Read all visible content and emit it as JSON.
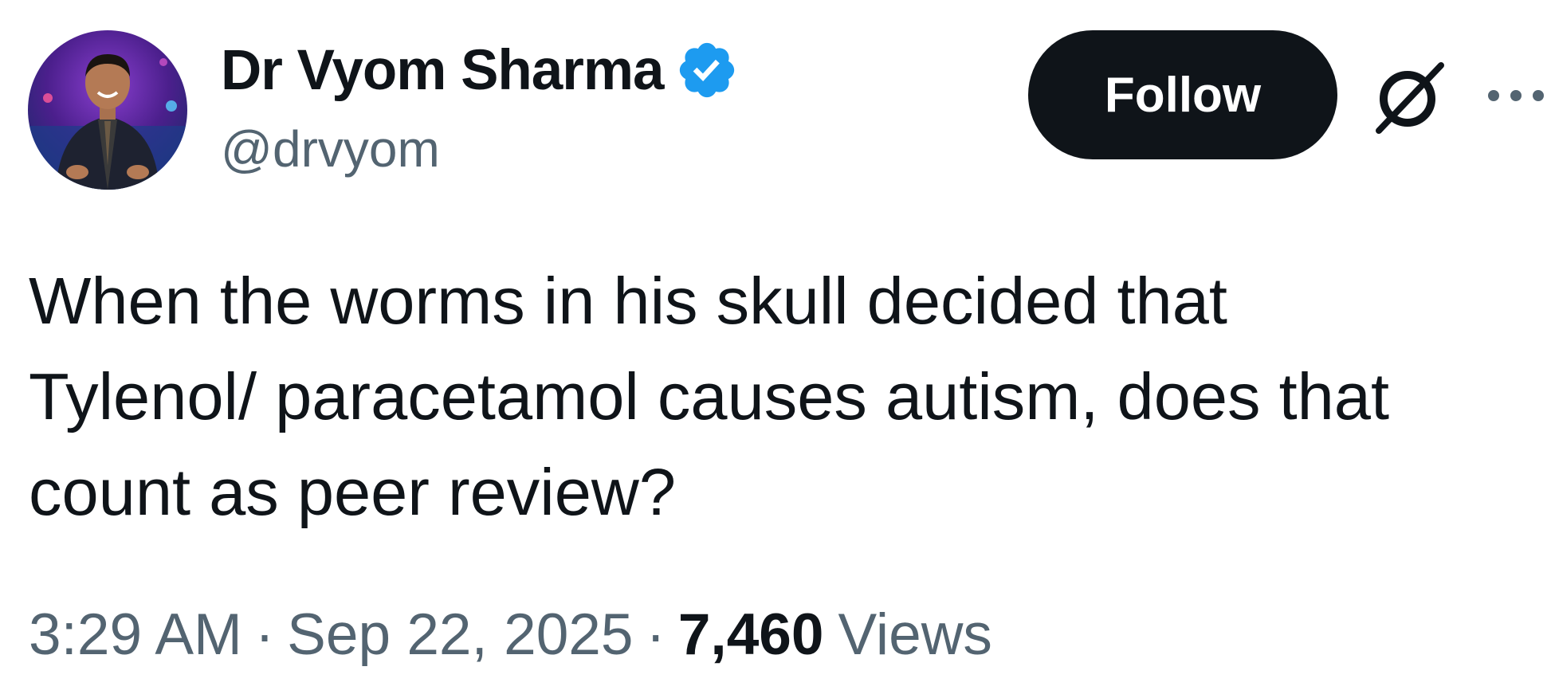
{
  "author": {
    "display_name": "Dr Vyom Sharma",
    "handle": "@drvyom",
    "verified": true,
    "verified_color": "#1d9bf0"
  },
  "actions": {
    "follow_label": "Follow",
    "grok_icon": "grok-icon",
    "more_icon": "more-icon"
  },
  "tweet": {
    "text": "When the worms in his skull decided that\nTylenol/ paracetamol causes autism, does that\ncount as peer review?"
  },
  "meta": {
    "time": "3:29 AM",
    "separator": "·",
    "date": "Sep 22, 2025",
    "views_count": "7,460",
    "views_label": "Views"
  },
  "colors": {
    "text_primary": "#0f1419",
    "text_secondary": "#536471",
    "button_bg": "#0f1419"
  }
}
